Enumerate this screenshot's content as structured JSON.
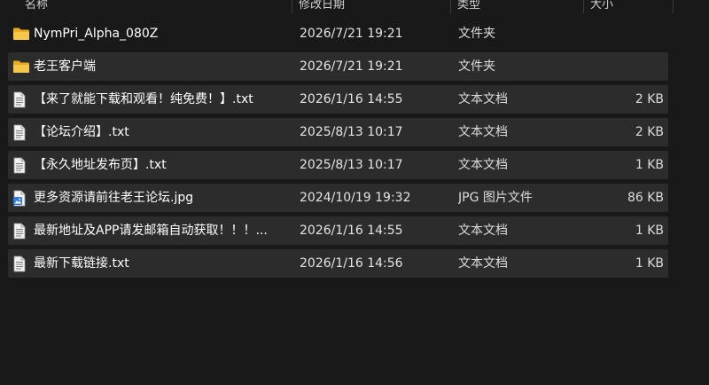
{
  "columns": {
    "name": "名称",
    "date": "修改日期",
    "type": "类型",
    "size": "大小"
  },
  "files": [
    {
      "name": "NymPri_Alpha_080Z",
      "date": "2026/7/21 19:21",
      "type": "文件夹",
      "size": "",
      "icon": "folder-icon"
    },
    {
      "name": "老王客户端",
      "date": "2026/7/21 19:21",
      "type": "文件夹",
      "size": "",
      "icon": "folder-icon"
    },
    {
      "name": "【来了就能下载和观看！纯免费！】.txt",
      "date": "2026/1/16 14:55",
      "type": "文本文档",
      "size": "2 KB",
      "icon": "text-file-icon"
    },
    {
      "name": "【论坛介绍】.txt",
      "date": "2025/8/13 10:17",
      "type": "文本文档",
      "size": "2 KB",
      "icon": "text-file-icon"
    },
    {
      "name": "【永久地址发布页】.txt",
      "date": "2025/8/13 10:17",
      "type": "文本文档",
      "size": "1 KB",
      "icon": "text-file-icon"
    },
    {
      "name": "更多资源请前往老王论坛.jpg",
      "date": "2024/10/19 19:32",
      "type": "JPG 图片文件",
      "size": "86 KB",
      "icon": "image-file-icon"
    },
    {
      "name": "最新地址及APP请发邮箱自动获取！！！...",
      "date": "2026/1/16 14:55",
      "type": "文本文档",
      "size": "1 KB",
      "icon": "text-file-icon"
    },
    {
      "name": "最新下载链接.txt",
      "date": "2026/1/16 14:56",
      "type": "文本文档",
      "size": "1 KB",
      "icon": "text-file-icon"
    }
  ]
}
